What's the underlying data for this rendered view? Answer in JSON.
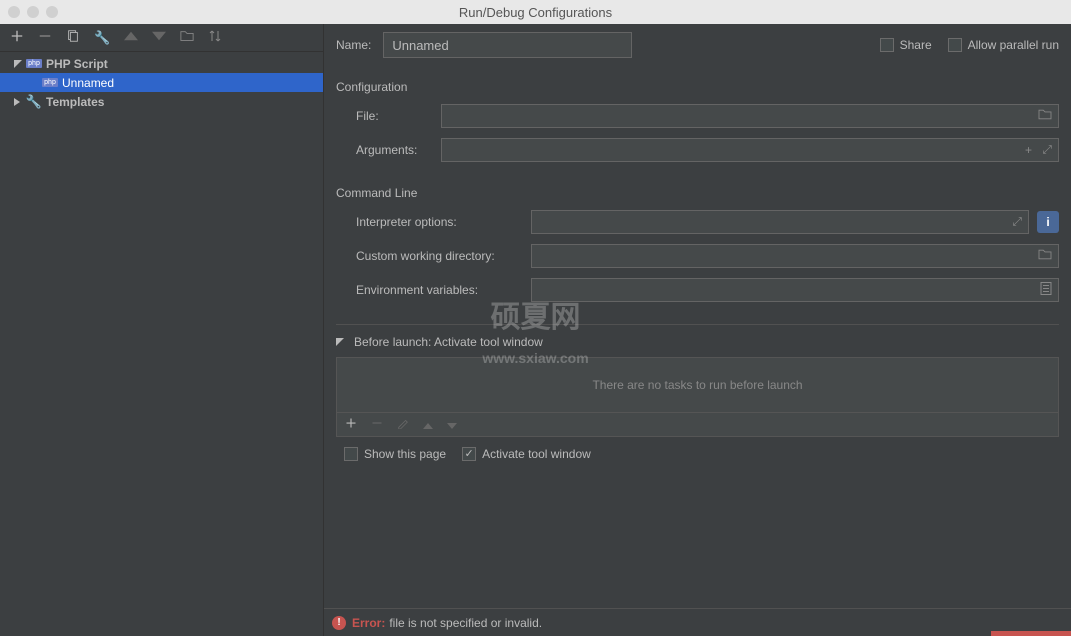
{
  "window": {
    "title": "Run/Debug Configurations"
  },
  "sidebar": {
    "tree": {
      "php_script_label": "PHP Script",
      "unnamed_label": "Unnamed",
      "templates_label": "Templates"
    }
  },
  "form": {
    "name_label": "Name:",
    "name_value": "Unnamed",
    "share_label": "Share",
    "allow_parallel_label": "Allow parallel run",
    "configuration_section": "Configuration",
    "file_label": "File:",
    "file_value": "",
    "arguments_label": "Arguments:",
    "arguments_value": "",
    "command_line_section": "Command Line",
    "interpreter_options_label": "Interpreter options:",
    "interpreter_options_value": "",
    "custom_dir_label": "Custom working directory:",
    "custom_dir_value": "",
    "env_vars_label": "Environment variables:",
    "env_vars_value": "",
    "before_launch_label": "Before launch: Activate tool window",
    "no_tasks_msg": "There are no tasks to run before launch",
    "show_this_page_label": "Show this page",
    "activate_tool_window_label": "Activate tool window"
  },
  "error": {
    "label": "Error:",
    "message": "file is not specified or invalid."
  },
  "watermark": {
    "main": "硕夏网",
    "sub": "www.sxiaw.com"
  }
}
